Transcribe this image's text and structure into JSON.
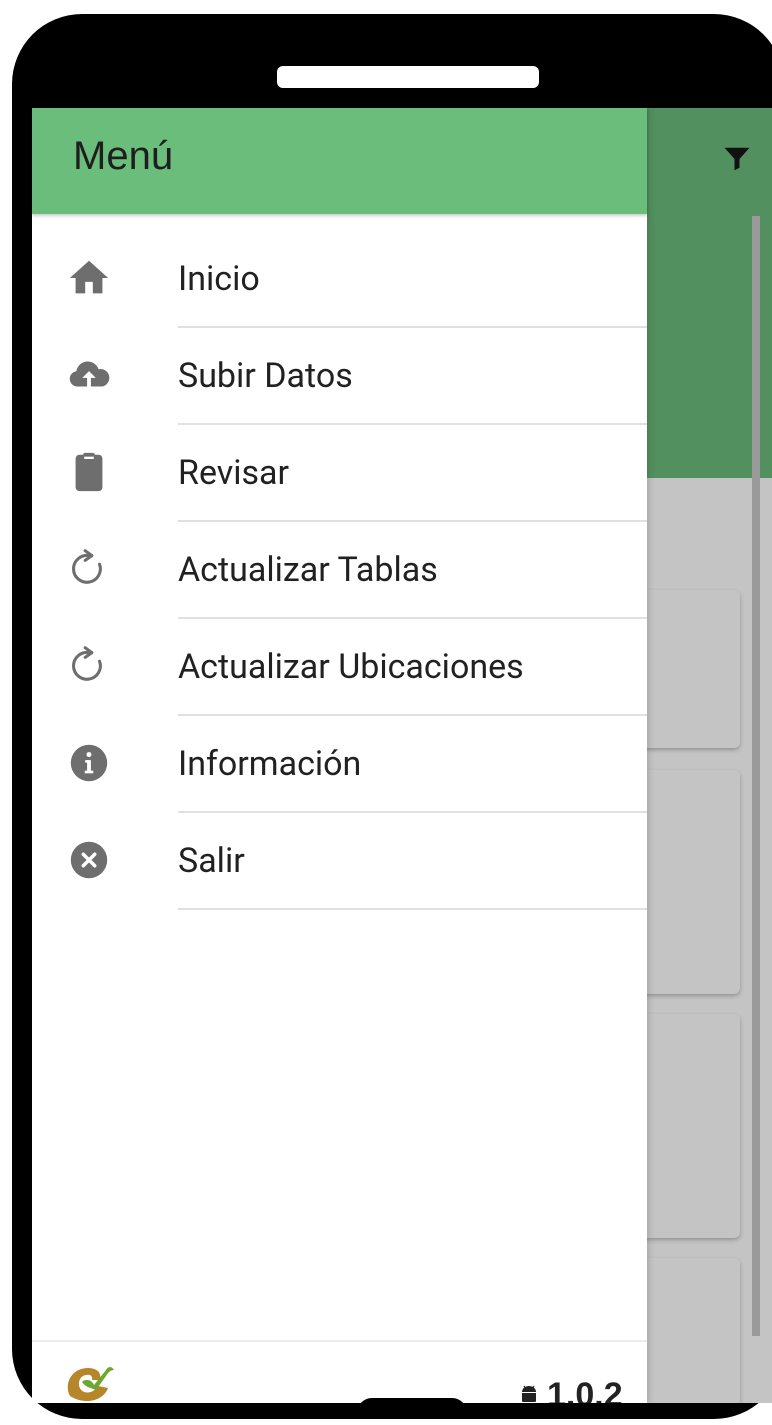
{
  "drawer": {
    "title": "Menú",
    "items": [
      {
        "label": "Inicio",
        "icon": "home-icon"
      },
      {
        "label": "Subir Datos",
        "icon": "cloud-upload-icon"
      },
      {
        "label": "Revisar",
        "icon": "clipboard-icon"
      },
      {
        "label": "Actualizar Tablas",
        "icon": "refresh-icon"
      },
      {
        "label": "Actualizar Ubicaciones",
        "icon": "refresh-icon"
      },
      {
        "label": "Información",
        "icon": "info-icon"
      },
      {
        "label": "Salir",
        "icon": "close-circle-icon"
      }
    ],
    "footer": {
      "version": "1.0.2",
      "logo": "app-logo",
      "platform_icon": "android-icon"
    }
  },
  "background_app": {
    "toolbar_icon": "filter-icon"
  },
  "colors": {
    "drawer_header": "#6bbd7c",
    "app_toolbar_dimmed": "#529060",
    "icon_gray": "#6e6e6e",
    "label_text": "#212121"
  }
}
